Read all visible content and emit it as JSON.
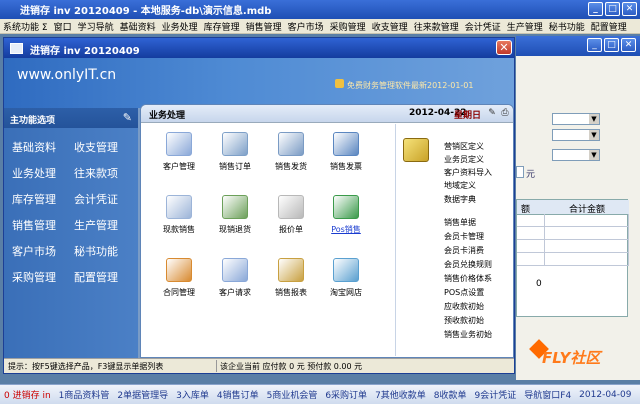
{
  "app": {
    "title": "进销存 inv 20120409 - 本地服务-db\\演示信息.mdb",
    "menu": [
      "系统功能 Σ",
      "窗口",
      "学习导航",
      "基础资料",
      "业务处理",
      "库存管理",
      "销售管理",
      "客户市场",
      "采购管理",
      "收支管理",
      "往来款管理",
      "会计凭证",
      "生产管理",
      "秘书功能",
      "配置管理"
    ]
  },
  "window": {
    "title": "进销存 inv 20120409",
    "close_glyph": "✕",
    "logo": "www.onlyIT.cn",
    "promo": "免费财务管理软件最新2012-01-01"
  },
  "side": {
    "header": "主功能选项",
    "items": [
      "基础资料",
      "收支管理",
      "业务处理",
      "往来款项",
      "库存管理",
      "会计凭证",
      "销售管理",
      "生产管理",
      "客户市场",
      "秘书功能",
      "采购管理",
      "配置管理"
    ]
  },
  "content": {
    "title": "业务处理",
    "date": "2012-04-22",
    "weekday": "星期日",
    "tiles": [
      {
        "label": "客户管理",
        "icon": "customer-icon",
        "color": "#8aa8d8"
      },
      {
        "label": "销售订单",
        "icon": "sales-order-icon",
        "color": "#7ea0c8"
      },
      {
        "label": "销售发货",
        "icon": "delivery-icon",
        "color": "#7a9bc4"
      },
      {
        "label": "销售发票",
        "icon": "invoice-icon",
        "color": "#5a86c0"
      },
      {
        "label": "现款销售",
        "icon": "cash-sale-icon",
        "color": "#9cb4d8"
      },
      {
        "label": "现销退货",
        "icon": "return-icon",
        "color": "#6ca05a"
      },
      {
        "label": "报价单",
        "icon": "quote-icon",
        "color": "#b8b8b8"
      },
      {
        "label": "Pos销售",
        "icon": "pos-icon",
        "color": "#3a9a4a"
      },
      {
        "label": "合同管理",
        "icon": "contract-icon",
        "color": "#d88a30"
      },
      {
        "label": "客户请求",
        "icon": "request-icon",
        "color": "#8aa8d8"
      },
      {
        "label": "销售报表",
        "icon": "report-icon",
        "color": "#c8a040"
      },
      {
        "label": "淘宝网店",
        "icon": "taobao-icon",
        "color": "#5aa0d0"
      }
    ],
    "links": [
      "营销区定义",
      "业务员定义",
      "客户资料导入",
      "地域定义",
      "数据字典",
      "销售单据",
      "会员卡管理",
      "会员卡消费",
      "会员兑换规则",
      "销售价格体系",
      "POS点设置",
      "应收款初始",
      "预收款初始",
      "销售业务初始"
    ]
  },
  "status": {
    "hint": "提示：按F5键选择产品，F3键显示单据列表",
    "summary": "该企业当前 应付款 0 元 预付款 0.00 元"
  },
  "taskbar": [
    "0 进销存 in",
    "1商品资料管",
    "2单据管理导",
    "3入库单",
    "4销售订单",
    "5商业机会管",
    "6采购订单",
    "7其他收款单",
    "8收款单",
    "9会计凭证",
    "导航窗口F4",
    "2012-04-09"
  ],
  "right_form": {
    "unit": "元",
    "grid_headers": [
      "额",
      "合计金额"
    ],
    "zero": "0"
  },
  "watermark": "FLY社区"
}
